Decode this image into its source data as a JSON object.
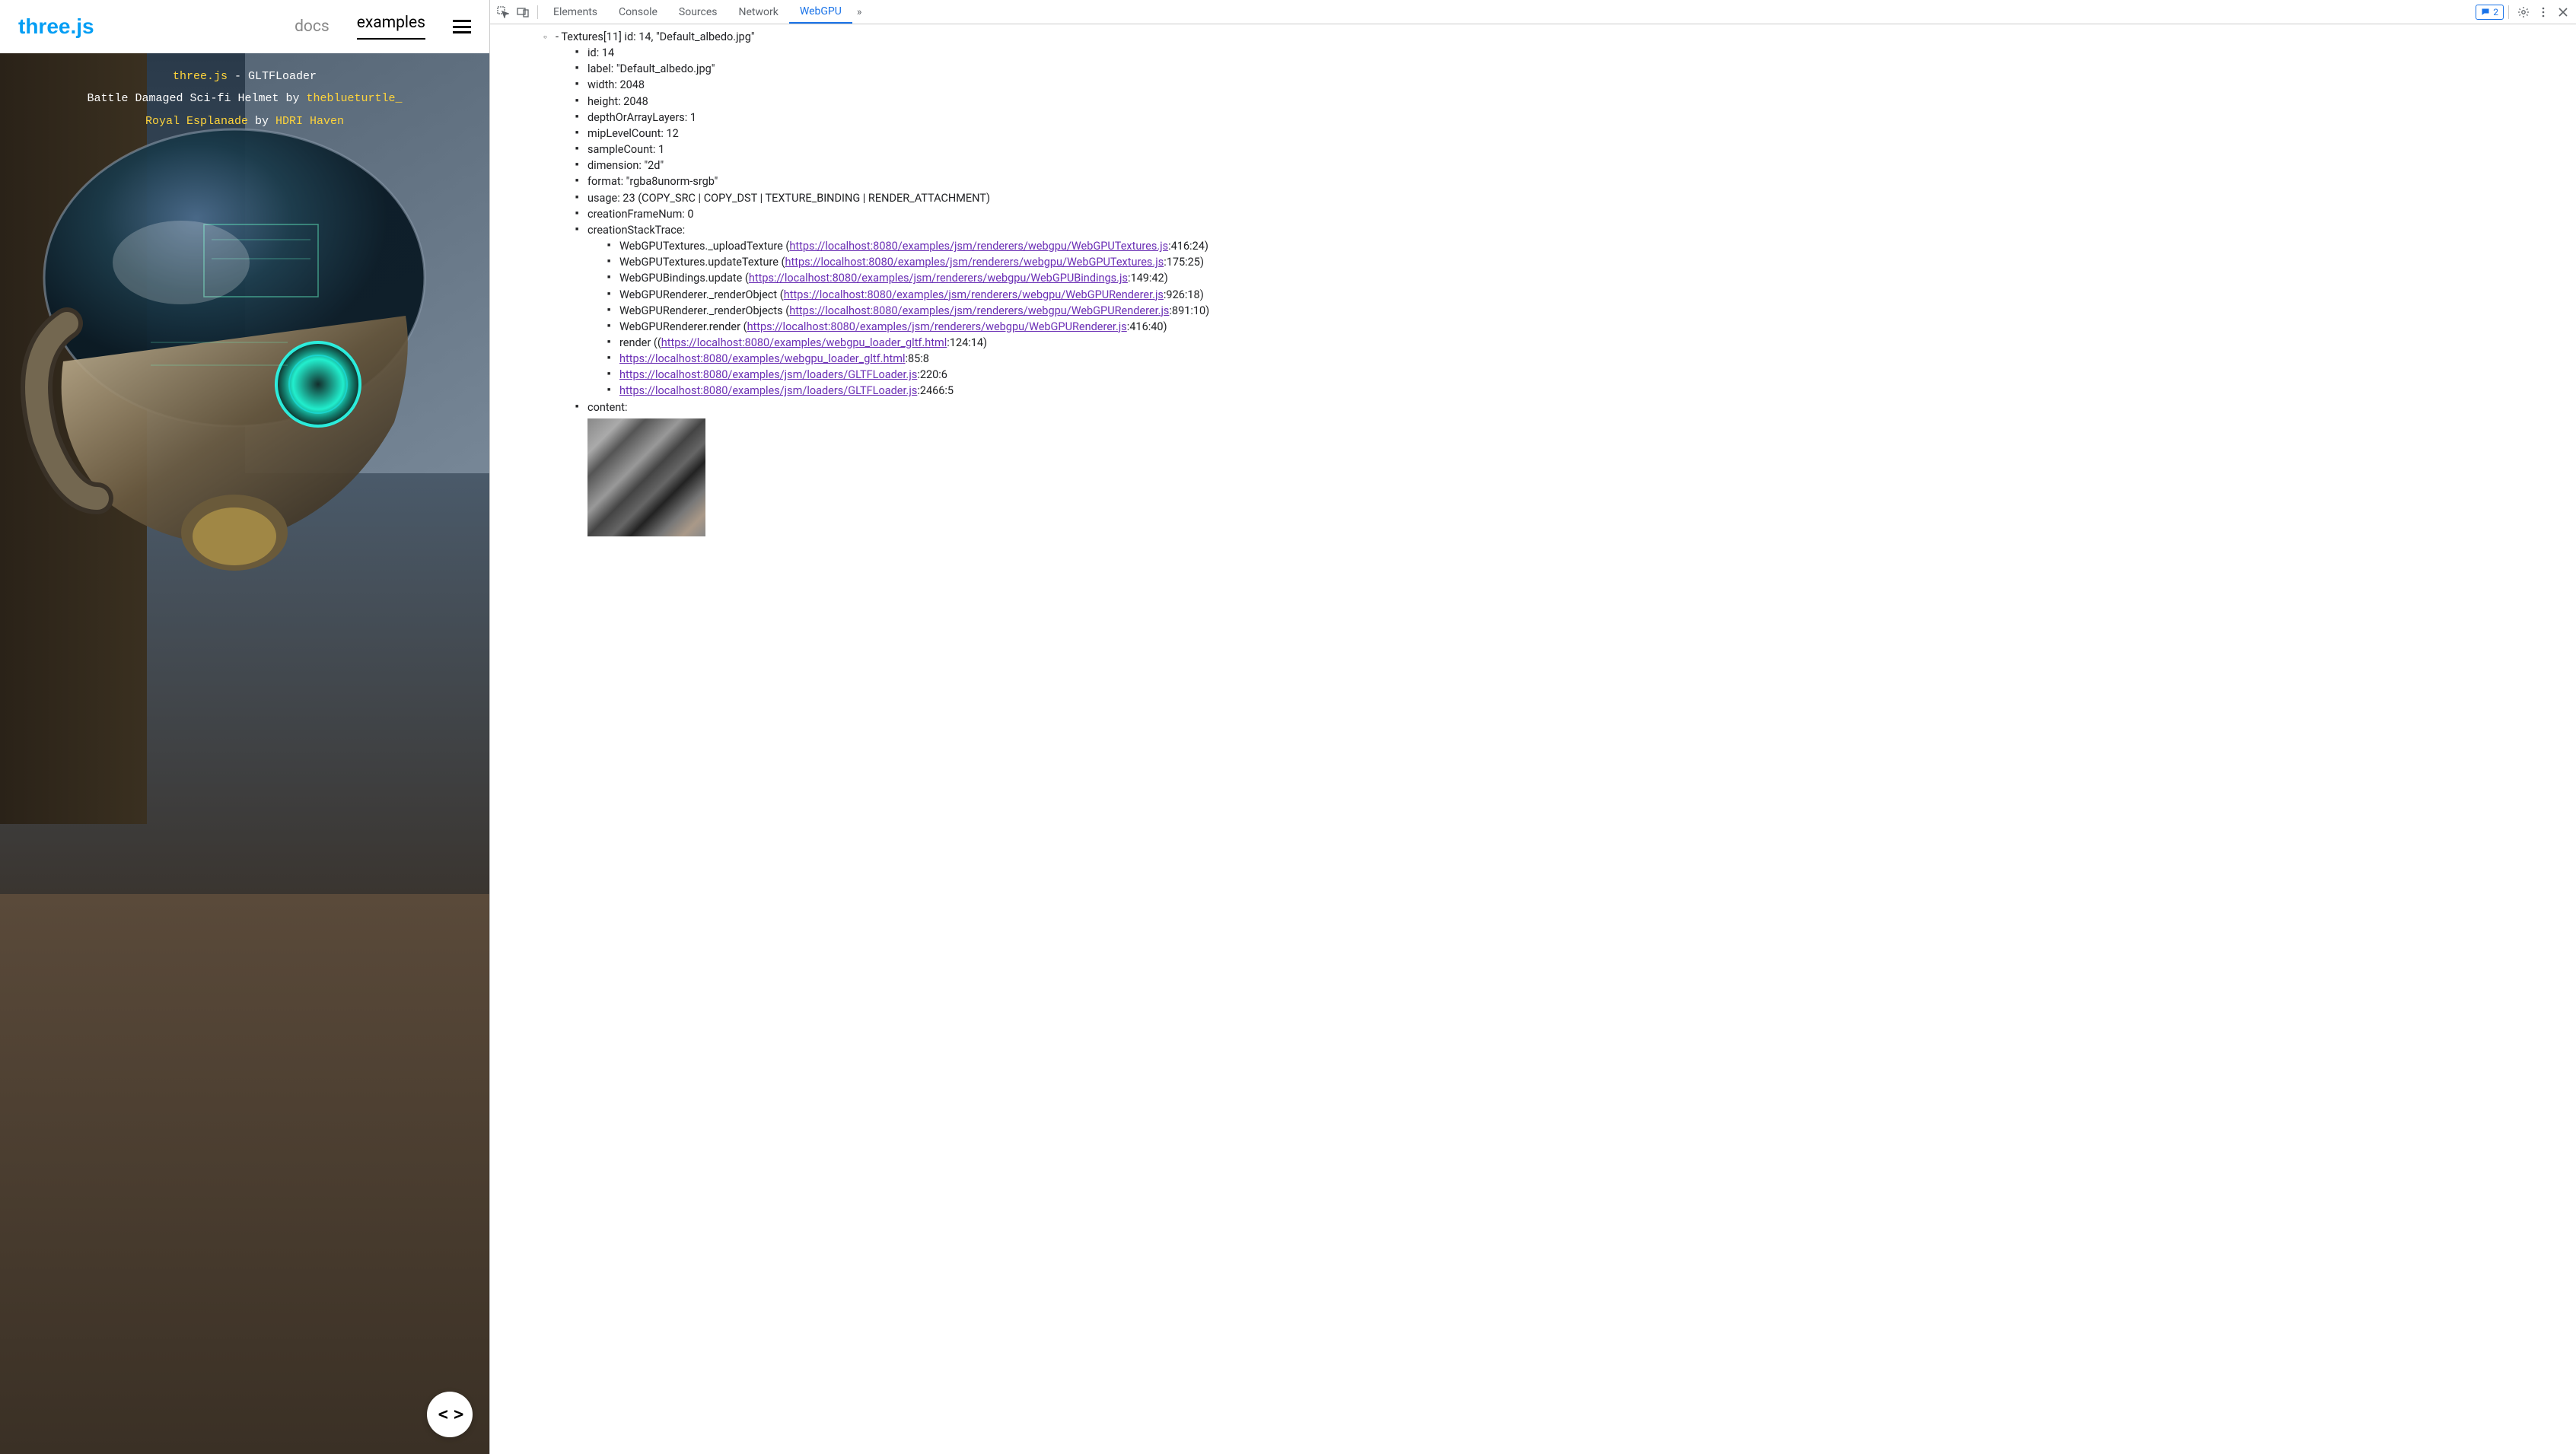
{
  "header": {
    "logo": "three.js",
    "navDocs": "docs",
    "navExamples": "examples"
  },
  "overlay": {
    "line1_link": "three.js",
    "line1_tail": " - GLTFLoader",
    "line2_prefix": "Battle Damaged Sci-fi Helmet by ",
    "line2_link": "theblueturtle_",
    "line3_link1": "Royal Esplanade",
    "line3_mid": " by ",
    "line3_link2": "HDRI Haven"
  },
  "codeButton": "< >",
  "devtools": {
    "tabs": {
      "elements": "Elements",
      "console": "Console",
      "sources": "Sources",
      "network": "Network",
      "webgpu": "WebGPU"
    },
    "chevrons": "»",
    "feedbackCount": "2"
  },
  "tree": {
    "textureLine": "- Textures[11] id: 14, \"Default_albedo.jpg\"",
    "props": {
      "id": "id: 14",
      "label": "label: \"Default_albedo.jpg\"",
      "width": "width: 2048",
      "height": "height: 2048",
      "depth": "depthOrArrayLayers: 1",
      "mip": "mipLevelCount: 12",
      "sample": "sampleCount: 1",
      "dimension": "dimension: \"2d\"",
      "format": "format: \"rgba8unorm-srgb\"",
      "usage": "usage: 23 (COPY_SRC | COPY_DST | TEXTURE_BINDING | RENDER_ATTACHMENT)",
      "creationFrame": "creationFrameNum: 0",
      "stackHeader": "creationStackTrace:",
      "content": "content:"
    },
    "stack": [
      {
        "fn": "WebGPUTextures._uploadTexture ",
        "url": "https://localhost:8080/examples/jsm/renderers/webgpu/WebGPUTextures.js",
        "loc": ":416:24)"
      },
      {
        "fn": "WebGPUTextures.updateTexture ",
        "url": "https://localhost:8080/examples/jsm/renderers/webgpu/WebGPUTextures.js",
        "loc": ":175:25)"
      },
      {
        "fn": "WebGPUBindings.update ",
        "url": "https://localhost:8080/examples/jsm/renderers/webgpu/WebGPUBindings.js",
        "loc": ":149:42)"
      },
      {
        "fn": "WebGPURenderer._renderObject ",
        "url": "https://localhost:8080/examples/jsm/renderers/webgpu/WebGPURenderer.js",
        "loc": ":926:18)"
      },
      {
        "fn": "WebGPURenderer._renderObjects ",
        "url": "https://localhost:8080/examples/jsm/renderers/webgpu/WebGPURenderer.js",
        "loc": ":891:10)"
      },
      {
        "fn": "WebGPURenderer.render ",
        "url": "https://localhost:8080/examples/jsm/renderers/webgpu/WebGPURenderer.js",
        "loc": ":416:40)"
      },
      {
        "fn": "render (",
        "url": "https://localhost:8080/examples/webgpu_loader_gltf.html",
        "loc": ":124:14)"
      }
    ],
    "tail": [
      {
        "url": "https://localhost:8080/examples/webgpu_loader_gltf.html",
        "loc": ":85:8"
      },
      {
        "url": "https://localhost:8080/examples/jsm/loaders/GLTFLoader.js",
        "loc": ":220:6"
      },
      {
        "url": "https://localhost:8080/examples/jsm/loaders/GLTFLoader.js",
        "loc": ":2466:5"
      }
    ]
  }
}
